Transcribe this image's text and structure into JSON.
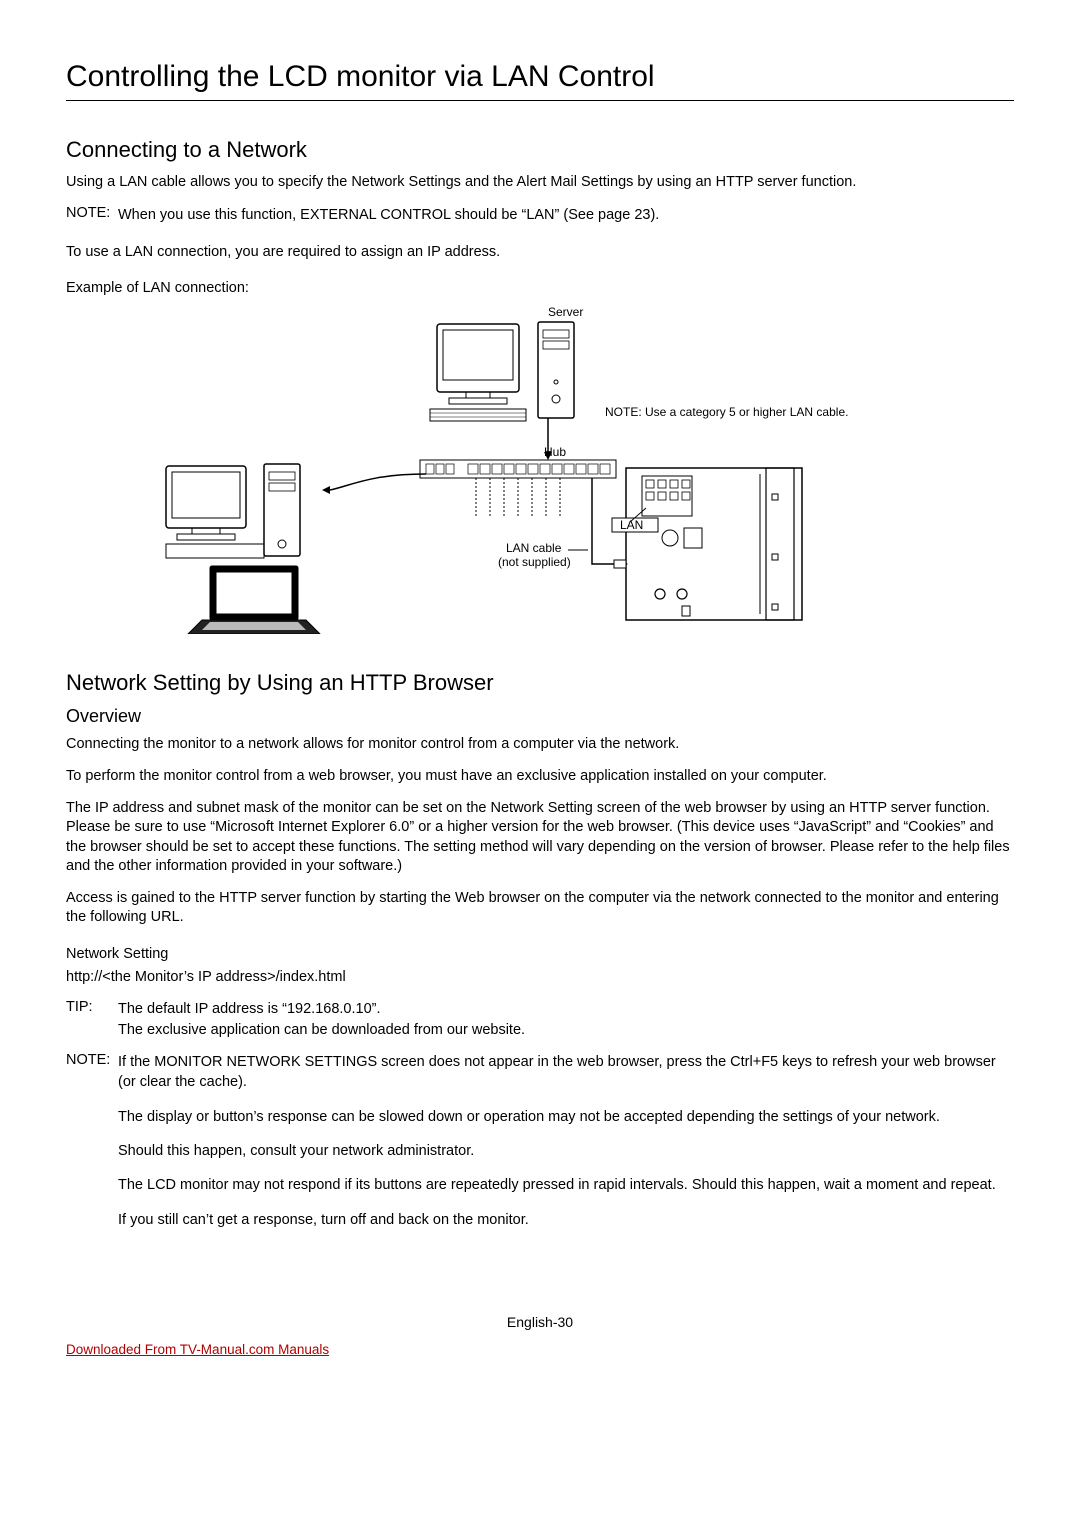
{
  "title": "Controlling the LCD monitor via LAN Control",
  "section1": {
    "heading": "Connecting to a Network",
    "p1": "Using a LAN cable allows you to specify the Network Settings and the Alert Mail Settings by using an HTTP server function.",
    "note_key": "NOTE:",
    "note_val": "When you use this function, EXTERNAL CONTROL should be “LAN” (See page 23).",
    "p2": "To use a LAN connection, you are required to assign an IP address.",
    "example_label": "Example of LAN connection:"
  },
  "diagram": {
    "server": "Server",
    "hub": "Hub",
    "lan": "LAN",
    "lan_cable": "LAN cable",
    "not_supplied": "(not supplied)",
    "cable_note": "NOTE: Use a category 5 or higher LAN cable."
  },
  "section2": {
    "heading": "Network Setting by Using an HTTP Browser",
    "subheading": "Overview",
    "p1": "Connecting the monitor to a network allows for monitor control from a computer via the network.",
    "p2": "To perform the monitor control from a web browser, you must have an exclusive application installed on your computer.",
    "p3": "The IP address and subnet mask of the monitor can be set on the Network Setting screen of the web browser by using an HTTP server function. Please be sure to use “Microsoft Internet Explorer 6.0” or a higher version for the web browser. (This device uses “JavaScript” and “Cookies” and the browser should be set to accept these functions. The setting method will vary depending on the version of browser. Please refer to the help files and the other information provided in your software.)",
    "p4": "Access is gained to the HTTP server function by starting the Web browser on the computer via the network connected to the monitor and entering the following URL.",
    "net_setting_label": "Network Setting",
    "url": "http://<the Monitor’s IP address>/index.html",
    "tip_key": "TIP:",
    "tip_val": "The default IP address is “192.168.0.10”.\nThe exclusive application can be downloaded from our website.",
    "note2_key": "NOTE:",
    "note2_p1": "If the MONITOR NETWORK SETTINGS screen does not appear in the web browser, press the Ctrl+F5 keys to refresh your web browser (or clear the cache).",
    "note2_p2": "The display or button’s response can be slowed down or operation may not be accepted depending the settings of your network.",
    "note2_p3": "Should this happen, consult your network administrator.",
    "note2_p4": "The LCD monitor may not respond if its buttons are repeatedly pressed in rapid intervals. Should this happen, wait a moment and repeat.",
    "note2_p5": "If you still can’t get a response, turn off and back on the monitor."
  },
  "footer": {
    "page": "English-30",
    "download": "Downloaded From TV-Manual.com Manuals"
  }
}
